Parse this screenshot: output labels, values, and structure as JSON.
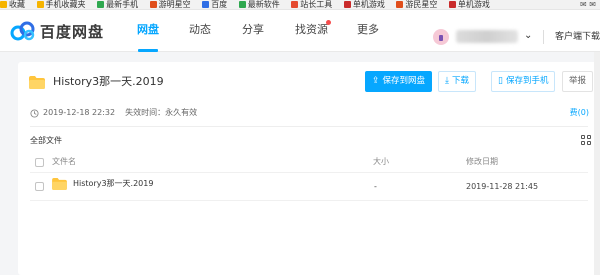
{
  "bookmarks": {
    "items": [
      {
        "label": "收藏",
        "color": "#f6b400"
      },
      {
        "label": "手机收藏夹",
        "color": "#f6b400"
      },
      {
        "label": "最新手机",
        "color": "#2fa84f"
      },
      {
        "label": "游明星空",
        "color": "#e04e1b"
      },
      {
        "label": "百度",
        "color": "#2f6ee5"
      },
      {
        "label": "最新软件",
        "color": "#2fa84f"
      },
      {
        "label": "站长工具",
        "color": "#e54a2f"
      },
      {
        "label": "单机游戏",
        "color": "#c92b2b"
      },
      {
        "label": "游民星空",
        "color": "#e04e1b"
      },
      {
        "label": "单机游戏",
        "color": "#c92b2b"
      }
    ],
    "right_glyphs": "✉ ✉"
  },
  "header": {
    "logo_text": "百度网盘",
    "nav": [
      {
        "label": "网盘",
        "active": true
      },
      {
        "label": "动态",
        "active": false
      },
      {
        "label": "分享",
        "active": false
      },
      {
        "label": "找资源",
        "active": false,
        "badge": true
      },
      {
        "label": "更多",
        "active": false
      }
    ],
    "user_chevron": "⌄",
    "client_download": "客户端下载"
  },
  "share": {
    "folder_name": "History3那一天.2019",
    "buttons": {
      "save": "保存到网盘",
      "download": "下载",
      "save_phone": "保存到手机",
      "report": "举报"
    },
    "created": "2019-12-18 22:32",
    "expiry": "失效时间：永久有效",
    "report_link": "费(0)",
    "all_files": "全部文件",
    "columns": {
      "name": "文件名",
      "size": "大小",
      "modified": "修改日期"
    },
    "files": [
      {
        "name": "History3那一天.2019",
        "size": "-",
        "modified": "2019-11-28 21:45"
      }
    ]
  },
  "colors": {
    "accent": "#06a7ff",
    "folder": "#ffc53d"
  }
}
